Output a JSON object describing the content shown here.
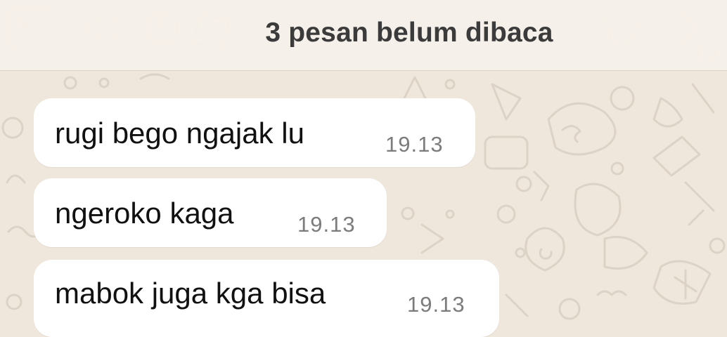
{
  "banner": {
    "label": "3 pesan belum dibaca"
  },
  "messages": [
    {
      "text": "rugi bego ngajak lu",
      "time": "19.13"
    },
    {
      "text": "ngeroko kaga",
      "time": "19.13"
    },
    {
      "text": "mabok juga kga bisa",
      "time": "19.13"
    }
  ],
  "colors": {
    "wallpaper": "#efe7dc",
    "doodle": "#dcd3c6",
    "bubble": "#ffffff",
    "message_text": "#111111",
    "timestamp": "#7c7c7c",
    "banner_text": "#3b3b3b"
  }
}
